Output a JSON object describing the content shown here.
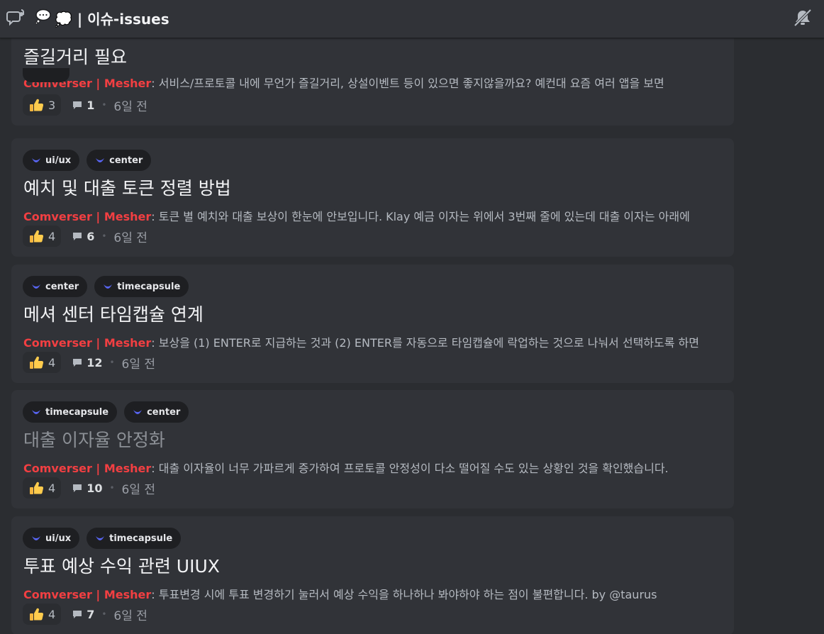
{
  "header": {
    "title": "💭 | 이슈-issues",
    "icons": [
      "threads-icon",
      "speech-bubble-icon",
      "muted-bell-icon"
    ]
  },
  "colors": {
    "background": "#313338",
    "list_background": "#2b2d31",
    "author": "#f23f42",
    "tag_background": "#1e1f22",
    "tag_icon": "#5865f2"
  },
  "posts": [
    {
      "tags": [],
      "title": "즐길거리 필요",
      "author": "Comverser | Mesher",
      "preview": "서비스/프로토콜 내에 무언가 즐길거리, 상설이벤트 등이 있으면 좋지않을까요? 예컨대 요즘 여러 앱을 보면",
      "reactions": "3",
      "comments": "1",
      "time": "6일 전"
    },
    {
      "tags": [
        "ui/ux",
        "center"
      ],
      "title": "예치 및 대출 토큰 정렬 방법",
      "author": "Comverser | Mesher",
      "preview": "토큰 별 예치와 대출 보상이 한눈에 안보입니다. Klay 예금 이자는 위에서 3번째 줄에 있는데 대출 이자는 아래에",
      "reactions": "4",
      "comments": "6",
      "time": "6일 전"
    },
    {
      "tags": [
        "center",
        "timecapsule"
      ],
      "title": "메셔 센터 타임캡슐 연계",
      "author": "Comverser | Mesher",
      "preview": "보상을 (1) ENTER로 지급하는 것과 (2) ENTER를 자동으로 타임캡슐에 락업하는 것으로 나눠서 선택하도록 하면",
      "reactions": "4",
      "comments": "12",
      "time": "6일 전"
    },
    {
      "tags": [
        "timecapsule",
        "center"
      ],
      "title": "대출 이자율 안정화",
      "title_muted": true,
      "author": "Comverser | Mesher",
      "preview": "대출 이자율이 너무 가파르게 증가하여 프로토콜 안정성이 다소 떨어질 수도 있는 상황인 것을 확인했습니다.",
      "reactions": "4",
      "comments": "10",
      "time": "6일 전"
    },
    {
      "tags": [
        "ui/ux",
        "timecapsule"
      ],
      "title": "투표 예상 수익 관련 UIUX",
      "author": "Comverser | Mesher",
      "preview": "투표변경 시에 투표 변경하기 눌러서 예상 수익을 하나하나 봐야하야 하는 점이 불편합니다. by  @taurus",
      "reactions": "4",
      "comments": "7",
      "time": "6일 전"
    }
  ]
}
